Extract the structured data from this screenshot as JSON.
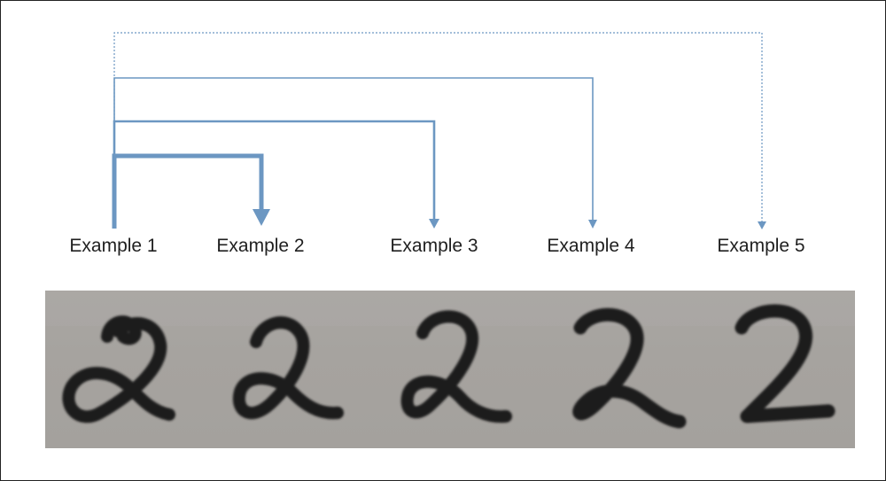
{
  "labels": {
    "ex1": "Example 1",
    "ex2": "Example 2",
    "ex3": "Example 3",
    "ex4": "Example 4",
    "ex5": "Example 5"
  },
  "colors": {
    "connector": "#6c97c2",
    "ink": "#1b1b1b",
    "paper": "#a7a4a0"
  },
  "photo": {
    "digits": [
      "2",
      "2",
      "2",
      "2",
      "2"
    ]
  }
}
